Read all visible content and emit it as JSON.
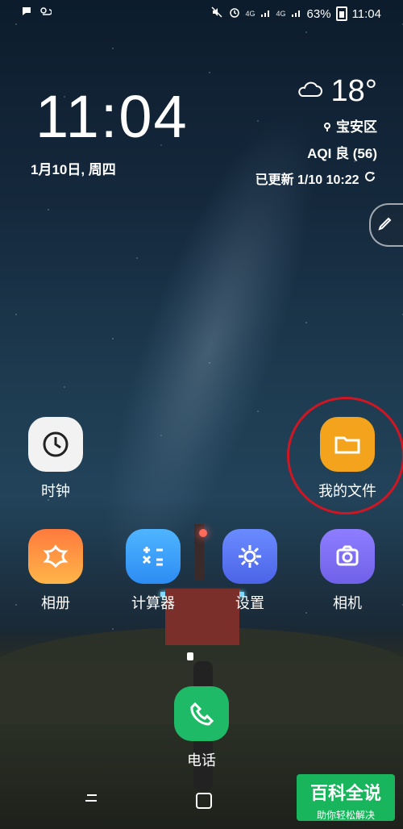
{
  "status_bar": {
    "network": "4G",
    "network2": "4G",
    "battery_text": "63%",
    "time": "11:04"
  },
  "lockscreen": {
    "clock": "11:04",
    "date": "1月10日, 周四",
    "weather": {
      "temperature": "18°",
      "location": "宝安区",
      "aqi": "AQI 良 (56)",
      "updated": "已更新 1/10 10:22"
    }
  },
  "apps": {
    "clock": "时钟",
    "my_files": "我的文件",
    "gallery": "相册",
    "calculator": "计算器",
    "settings": "设置",
    "camera": "相机",
    "phone": "电话"
  },
  "watermark": {
    "title": "百科全说",
    "subtitle": "助你轻松解决"
  },
  "colors": {
    "highlight_circle": "#d01622",
    "watermark_bg": "#19b55d"
  }
}
